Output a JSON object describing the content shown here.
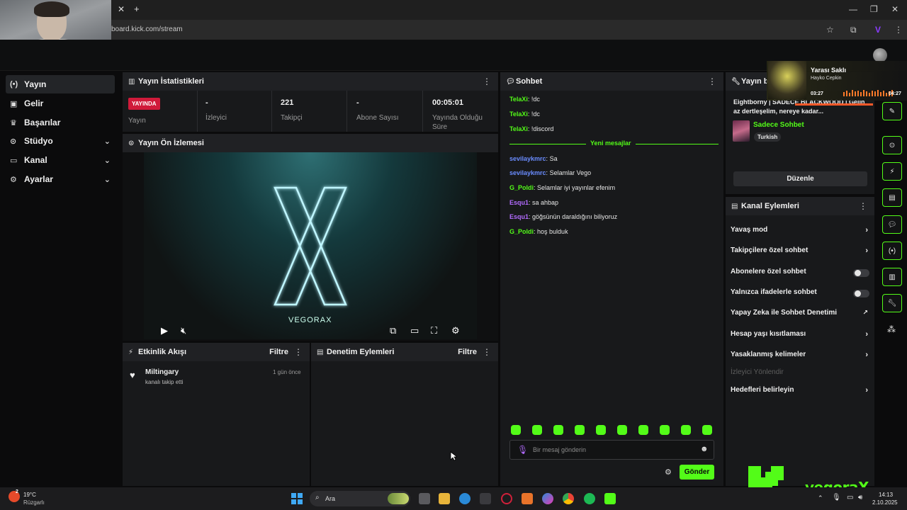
{
  "browser": {
    "url": "board.kick.com/stream"
  },
  "sidebar": {
    "items": [
      {
        "label": "Yayın",
        "icon": "broadcast-icon",
        "active": true,
        "expandable": false
      },
      {
        "label": "Gelir",
        "icon": "revenue-icon",
        "active": false,
        "expandable": false
      },
      {
        "label": "Başarılar",
        "icon": "trophy-icon",
        "active": false,
        "expandable": false
      },
      {
        "label": "Stüdyo",
        "icon": "studio-icon",
        "active": false,
        "expandable": true
      },
      {
        "label": "Kanal",
        "icon": "channel-icon",
        "active": false,
        "expandable": true
      },
      {
        "label": "Ayarlar",
        "icon": "gear-icon",
        "active": false,
        "expandable": true
      }
    ]
  },
  "stats": {
    "title": "Yayın İstatistikleri",
    "badge": "YAYINDA",
    "items": [
      {
        "value": "",
        "label": "Yayın"
      },
      {
        "value": "-",
        "label": "İzleyici"
      },
      {
        "value": "221",
        "label": "Takipçi"
      },
      {
        "value": "-",
        "label": "Abone Sayısı"
      },
      {
        "value": "00:05:01",
        "label": "Yayında Olduğu Süre"
      }
    ]
  },
  "preview": {
    "title": "Yayın Ön İzlemesi",
    "overlay_text": "VEGORAX"
  },
  "activity": {
    "title": "Etkinlik Akışı",
    "filter": "Filtre",
    "events": [
      {
        "user": "Miltingary",
        "action": "kanalı takip etti",
        "time": "1 gün önce"
      }
    ]
  },
  "moderation": {
    "title": "Denetim Eylemleri",
    "filter": "Filtre"
  },
  "chat": {
    "title": "Sohbet",
    "divider": "Yeni mesajlar",
    "old_messages": [
      {
        "user": "TelaXi",
        "text": "!dc",
        "color": "green"
      },
      {
        "user": "TelaXi",
        "text": "!dc",
        "color": "green"
      },
      {
        "user": "TelaXi",
        "text": "!discord",
        "color": "green"
      }
    ],
    "new_messages": [
      {
        "user": "sevilaykmrc",
        "text": "Sa",
        "color": "blue"
      },
      {
        "user": "sevilaykmrc",
        "text": "Selamlar Vego",
        "color": "blue"
      },
      {
        "user": "G_Poldi",
        "text": "Selamlar iyi yayınlar efenim",
        "color": "green"
      },
      {
        "user": "Esqu1",
        "text": "sa ahbap",
        "color": "purple"
      },
      {
        "user": "Esqu1",
        "text": "göğsünün daraldığını biliyoruz",
        "color": "purple"
      },
      {
        "user": "G_Poldi",
        "text": "hoş bulduk",
        "color": "green"
      }
    ],
    "input_placeholder": "Bir mesaj gönderin",
    "send_label": "Gönder"
  },
  "stream_info": {
    "title": "Yayın bi",
    "stream_title": "Eightborny | SADECE BLACKWOOD | Gelin az dertleşelim, nereye kadar...",
    "category": "Sadece Sohbet",
    "language": "Turkish",
    "edit_label": "Düzenle"
  },
  "channel_actions": {
    "title": "Kanal Eylemleri",
    "items": [
      {
        "label": "Yavaş mod",
        "kind": "chevron",
        "disabled": false
      },
      {
        "label": "Takipçilere özel sohbet",
        "kind": "chevron",
        "disabled": false
      },
      {
        "label": "Abonelere özel sohbet",
        "kind": "toggle",
        "disabled": false
      },
      {
        "label": "Yalnızca ifadelerle sohbet",
        "kind": "toggle",
        "disabled": false
      },
      {
        "label": "Yapay Zeka ile Sohbet Denetimi",
        "kind": "external",
        "disabled": false
      },
      {
        "label": "Hesap yaşı kısıtlaması",
        "kind": "chevron",
        "disabled": false
      },
      {
        "label": "Yasaklanmış kelimeler",
        "kind": "chevron",
        "disabled": false
      },
      {
        "label": "İzleyici Yönlendir",
        "kind": "none",
        "disabled": true
      },
      {
        "label": "Hedefleri belirleyin",
        "kind": "chevron",
        "disabled": false
      }
    ]
  },
  "music": {
    "title": "Yarası Saklı",
    "artist": "Hayko Cepkin",
    "elapsed": "03:27",
    "duration": "04:27"
  },
  "brand": "vegoraX",
  "taskbar": {
    "weather_temp": "19°C",
    "weather_desc": "Rüzgarlı",
    "weather_badge": "2",
    "search_placeholder": "Ara",
    "time": "14:13",
    "date": "2.10.2025"
  },
  "colors": {
    "kick_green": "#53fc18",
    "live_red": "#d01a3a",
    "panel_bg": "#18191b"
  }
}
